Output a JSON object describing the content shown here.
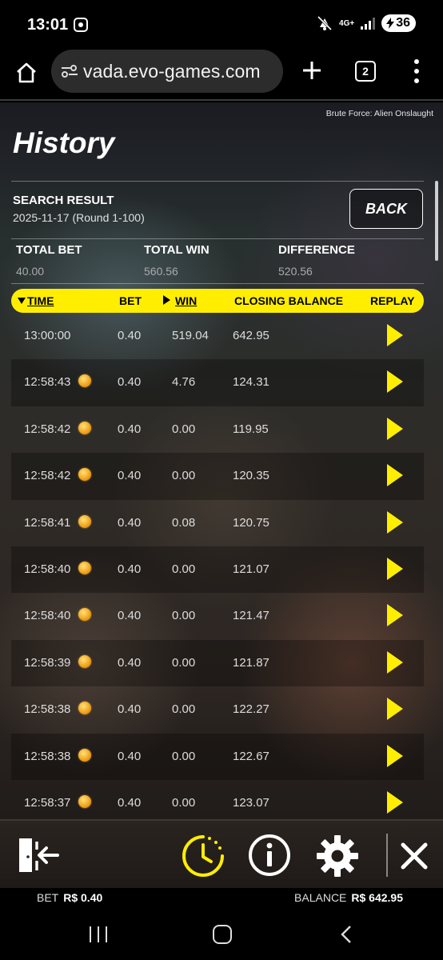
{
  "status_bar": {
    "time": "13:01",
    "network": "4G+",
    "battery": "36"
  },
  "browser": {
    "url": "vada.evo-games.com",
    "tab_count": "2"
  },
  "game": {
    "name": "Brute Force: Alien Onslaught",
    "page_title": "History",
    "search_label": "SEARCH RESULT",
    "search_date": "2025-11-17 (Round 1-100)",
    "back_label": "BACK",
    "totals": {
      "total_bet_label": "TOTAL BET",
      "total_bet": "40.00",
      "total_win_label": "TOTAL WIN",
      "total_win": "560.56",
      "difference_label": "DIFFERENCE",
      "difference": "520.56"
    },
    "table": {
      "headers": {
        "time": "TIME",
        "bet": "BET",
        "win": "WIN",
        "closing_balance": "CLOSING BALANCE",
        "replay": "REPLAY"
      },
      "rows": [
        {
          "time": "13:00:00",
          "coin": false,
          "bet": "0.40",
          "win": "519.04",
          "balance": "642.95"
        },
        {
          "time": "12:58:43",
          "coin": true,
          "bet": "0.40",
          "win": "4.76",
          "balance": "124.31"
        },
        {
          "time": "12:58:42",
          "coin": true,
          "bet": "0.40",
          "win": "0.00",
          "balance": "119.95"
        },
        {
          "time": "12:58:42",
          "coin": true,
          "bet": "0.40",
          "win": "0.00",
          "balance": "120.35"
        },
        {
          "time": "12:58:41",
          "coin": true,
          "bet": "0.40",
          "win": "0.08",
          "balance": "120.75"
        },
        {
          "time": "12:58:40",
          "coin": true,
          "bet": "0.40",
          "win": "0.00",
          "balance": "121.07"
        },
        {
          "time": "12:58:40",
          "coin": true,
          "bet": "0.40",
          "win": "0.00",
          "balance": "121.47"
        },
        {
          "time": "12:58:39",
          "coin": true,
          "bet": "0.40",
          "win": "0.00",
          "balance": "121.87"
        },
        {
          "time": "12:58:38",
          "coin": true,
          "bet": "0.40",
          "win": "0.00",
          "balance": "122.27"
        },
        {
          "time": "12:58:38",
          "coin": true,
          "bet": "0.40",
          "win": "0.00",
          "balance": "122.67"
        },
        {
          "time": "12:58:37",
          "coin": true,
          "bet": "0.40",
          "win": "0.00",
          "balance": "123.07"
        }
      ]
    }
  },
  "footer": {
    "bet_label": "BET",
    "bet_value": "R$ 0.40",
    "balance_label": "BALANCE",
    "balance_value": "R$ 642.95"
  },
  "colors": {
    "accent": "#ffee00",
    "coin": "#f0a018"
  },
  "icons": [
    "home-icon",
    "tune-icon",
    "plus-icon",
    "tabs-icon",
    "menu-icon",
    "exit-icon",
    "history-clock-icon",
    "info-icon",
    "gear-icon",
    "close-icon",
    "play-icon",
    "coin-icon"
  ]
}
